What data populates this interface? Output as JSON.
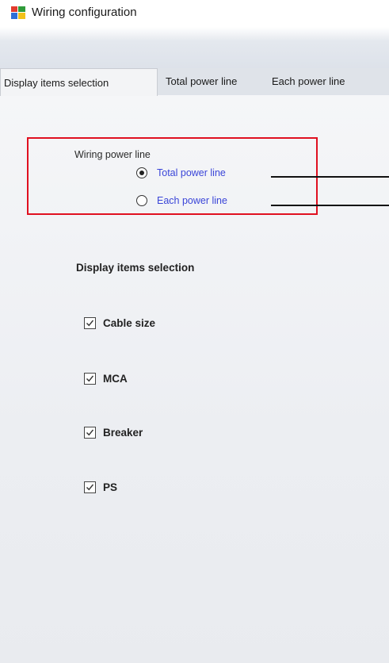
{
  "window": {
    "title": "Wiring configuration"
  },
  "tabs": [
    {
      "label": "Display items selection",
      "active": true
    },
    {
      "label": "Total power line",
      "active": false
    },
    {
      "label": "Each power line",
      "active": false
    }
  ],
  "wiring_group": {
    "label": "Wiring power line",
    "options": [
      {
        "label": "Total power line",
        "selected": true
      },
      {
        "label": "Each power line",
        "selected": false
      }
    ]
  },
  "display_items": {
    "title": "Display items selection",
    "items": [
      {
        "label": "Cable size",
        "checked": true
      },
      {
        "label": "MCA",
        "checked": true
      },
      {
        "label": "Breaker",
        "checked": true
      },
      {
        "label": "PS",
        "checked": true
      }
    ]
  },
  "colors": {
    "highlight_box": "#e01020",
    "radio_text": "#3a45d8"
  },
  "icons": {
    "app": "colored-window-icon"
  }
}
